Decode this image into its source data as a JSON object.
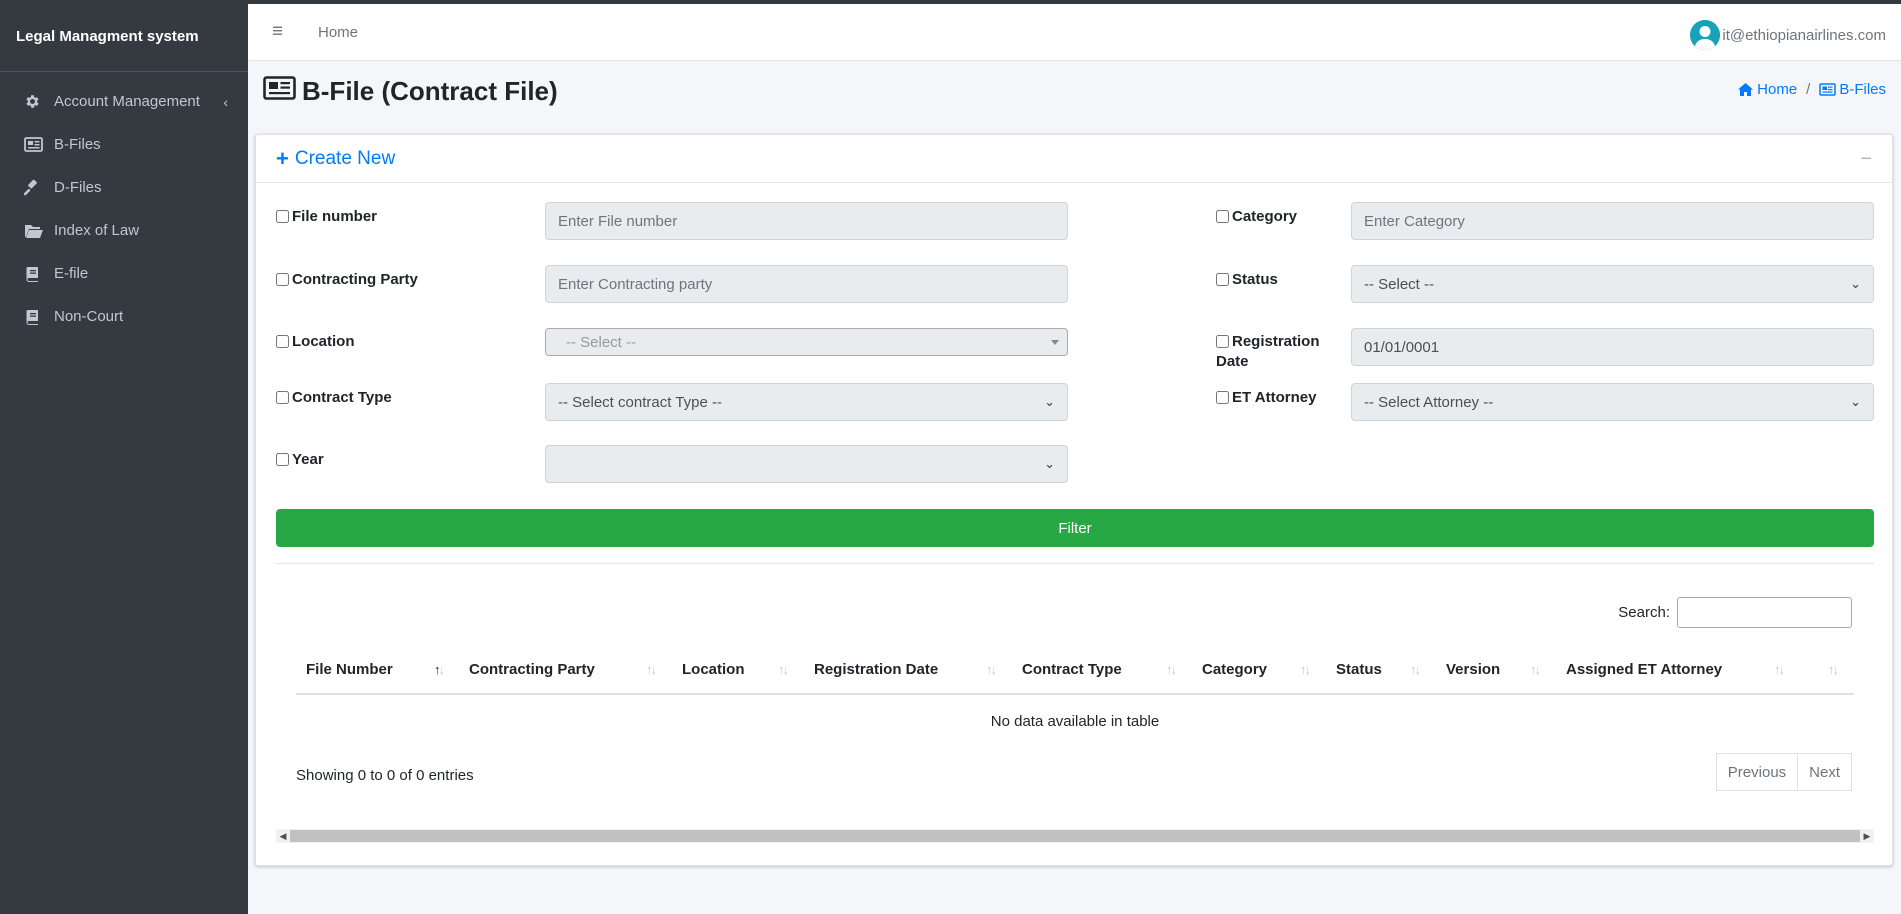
{
  "app": {
    "brand": "Legal Managment system"
  },
  "sidebar": {
    "items": [
      {
        "label": "Account Management",
        "icon": "gear-icon",
        "has_children": true
      },
      {
        "label": "B-Files",
        "icon": "newspaper-icon"
      },
      {
        "label": "D-Files",
        "icon": "gavel-icon"
      },
      {
        "label": "Index of Law",
        "icon": "folder-open-icon"
      },
      {
        "label": "E-file",
        "icon": "book-icon"
      },
      {
        "label": "Non-Court",
        "icon": "book-icon"
      }
    ]
  },
  "navbar": {
    "home_label": "Home",
    "user_email": "it@ethiopianairlines.com"
  },
  "page": {
    "title": "B-File (Contract File)",
    "breadcrumb": {
      "home": "Home",
      "current": "B-Files"
    }
  },
  "card": {
    "create_new_label": "Create New",
    "collapse_symbol": "−"
  },
  "form": {
    "file_number": {
      "label": "File number",
      "placeholder": "Enter File number"
    },
    "contracting_party": {
      "label": "Contracting Party",
      "placeholder": "Enter Contracting party"
    },
    "location": {
      "label": "Location",
      "selected": "-- Select --"
    },
    "contract_type": {
      "label": "Contract Type",
      "selected": "-- Select contract Type --"
    },
    "year": {
      "label": "Year",
      "selected": ""
    },
    "category": {
      "label": "Category",
      "placeholder": "Enter Category"
    },
    "status": {
      "label": "Status",
      "selected": "-- Select --"
    },
    "registration_date": {
      "label_line1": "Registration",
      "label_line2": "Date",
      "value": "01/01/0001"
    },
    "et_attorney": {
      "label": "ET Attorney",
      "selected": "-- Select Attorney --"
    },
    "filter_label": "Filter"
  },
  "table": {
    "search_label": "Search:",
    "columns": [
      "File Number",
      "Contracting Party",
      "Location",
      "Registration Date",
      "Contract Type",
      "Category",
      "Status",
      "Version",
      "Assigned ET Attorney"
    ],
    "empty_message": "No data available in table",
    "info": "Showing 0 to 0 of 0 entries",
    "previous_label": "Previous",
    "next_label": "Next"
  },
  "colors": {
    "sidebar_bg": "#343a40",
    "primary": "#007bff",
    "success": "#28a745",
    "avatar": "#17a2b8"
  }
}
